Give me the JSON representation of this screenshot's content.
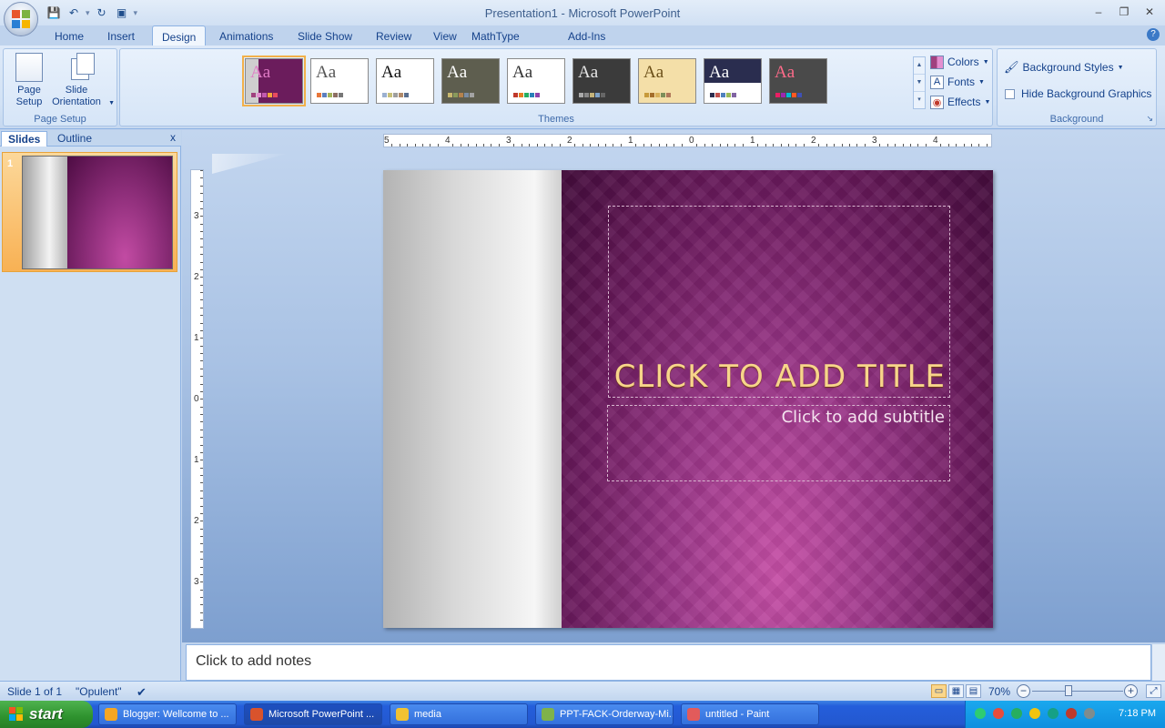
{
  "window": {
    "title": "Presentation1 - Microsoft PowerPoint",
    "minimize": "–",
    "restore": "❐",
    "close": "✕"
  },
  "qat": {
    "save": "💾",
    "undo": "↶",
    "redo": "↻",
    "view": "▣",
    "customize": "▾"
  },
  "tabs": [
    "Home",
    "Insert",
    "Design",
    "Animations",
    "Slide Show",
    "Review",
    "View",
    "MathType",
    "Add-Ins"
  ],
  "active_tab": "Design",
  "help": "?",
  "ribbon": {
    "page_setup_group": {
      "label": "Page Setup",
      "page_setup": "Page Setup",
      "slide_orientation": "Slide Orientation"
    },
    "themes_group": {
      "label": "Themes",
      "glyph": "Aa",
      "themes": [
        {
          "bg": "#6b1c5c",
          "fg": "#e07bc6",
          "left": "#cfcfcf",
          "selected": true,
          "swatches": [
            "#a0417f",
            "#e48fd0",
            "#c25bb0",
            "#f2a73b",
            "#e84a5f"
          ]
        },
        {
          "bg": "#ffffff",
          "fg": "#555555",
          "selected": false,
          "swatches": [
            "#e8763a",
            "#5b7fbf",
            "#a3b35a",
            "#8d6e63",
            "#777777"
          ]
        },
        {
          "bg": "#ffffff",
          "fg": "#111111",
          "selected": false,
          "swatches": [
            "#9bb0d0",
            "#c7c07a",
            "#9e9e9e",
            "#b08a6a",
            "#5a6f8f"
          ]
        },
        {
          "bg": "#5e5e4f",
          "fg": "#ffffff",
          "selected": false,
          "swatches": [
            "#c9b86f",
            "#8a9a5b",
            "#b5824d",
            "#7a8ca3",
            "#a3a3a3"
          ]
        },
        {
          "bg": "#ffffff",
          "fg": "#333333",
          "selected": false,
          "swatches": [
            "#c0392b",
            "#e67e22",
            "#27ae60",
            "#2980b9",
            "#8e44ad"
          ]
        },
        {
          "bg": "#3b3b3b",
          "fg": "#e6e6e6",
          "selected": false,
          "swatches": [
            "#aaaaaa",
            "#888888",
            "#c4b37a",
            "#7fa3c8",
            "#666666"
          ]
        },
        {
          "bg": "#f4dfa8",
          "fg": "#6b4f18",
          "selected": false,
          "swatches": [
            "#c79a3b",
            "#a46e2c",
            "#d8b15b",
            "#7d8f5a",
            "#b1785a"
          ]
        },
        {
          "bg": "#ffffff",
          "fg": "#ffffff",
          "top": "#2a2d4f",
          "selected": false,
          "swatches": [
            "#2a2d4f",
            "#c0504d",
            "#4f81bd",
            "#9bbb59",
            "#8064a2"
          ]
        },
        {
          "bg": "#4a4a4a",
          "fg": "#ff6b8a",
          "selected": false,
          "swatches": [
            "#e91e63",
            "#9c27b0",
            "#00bcd4",
            "#ff5722",
            "#3f51b5"
          ]
        }
      ],
      "scroll": [
        "▲",
        "▼",
        "▾"
      ],
      "colors": "Colors",
      "fonts": "Fonts",
      "effects": "Effects"
    },
    "background_group": {
      "label": "Background",
      "background_styles": "Background Styles",
      "hide_graphics": "Hide Background Graphics",
      "launcher": "↘"
    }
  },
  "left_pane": {
    "tabs": [
      "Slides",
      "Outline"
    ],
    "close": "x",
    "slide_number": "1"
  },
  "rulers": {
    "h": [
      "5",
      "4",
      "3",
      "2",
      "1",
      "0",
      "1",
      "2",
      "3",
      "4"
    ],
    "v": [
      "3",
      "2",
      "1",
      "0",
      "1",
      "2",
      "3"
    ]
  },
  "slide": {
    "title_placeholder": "CLICK TO ADD TITLE",
    "subtitle_placeholder": "Click to add subtitle"
  },
  "notes": {
    "placeholder": "Click to add notes"
  },
  "status": {
    "slide": "Slide 1 of 1",
    "theme": "\"Opulent\"",
    "zoom": "70%",
    "zoom_out": "−",
    "zoom_in": "+",
    "zoom_level": 0.4
  },
  "taskbar": {
    "start": "start",
    "tasks": [
      {
        "label": "Blogger: Wellcome to ...",
        "color": "#f5a623",
        "active": false
      },
      {
        "label": "Microsoft PowerPoint ...",
        "color": "#d9532c",
        "active": true
      },
      {
        "label": "media",
        "color": "#f1c232",
        "active": false
      },
      {
        "label": "PPT-FACK-Orderway-Mi...",
        "color": "#7fb24a",
        "active": false
      },
      {
        "label": "untitled - Paint",
        "color": "#e25b5b",
        "active": false
      }
    ],
    "clock": "7:18 PM"
  }
}
